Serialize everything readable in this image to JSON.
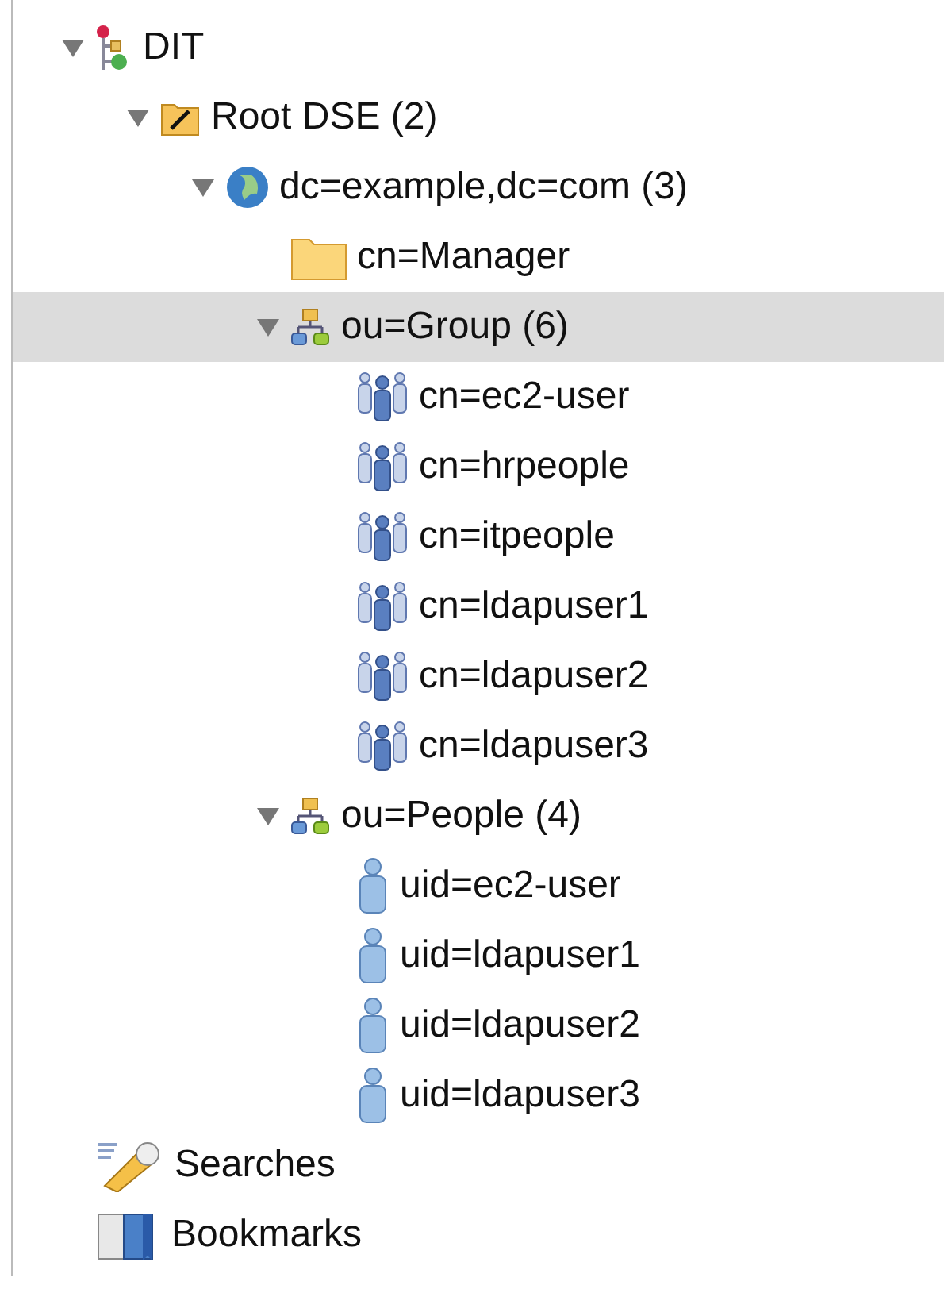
{
  "tree": [
    {
      "kind": "dit",
      "label": "DIT",
      "expanded": true,
      "selected": false,
      "children": [
        {
          "kind": "root",
          "label": "Root DSE (2)",
          "expanded": true,
          "selected": false,
          "children": [
            {
              "kind": "domain",
              "label": "dc=example,dc=com (3)",
              "expanded": true,
              "selected": false,
              "children": [
                {
                  "kind": "folder",
                  "label": "cn=Manager",
                  "selected": false
                },
                {
                  "kind": "ou",
                  "label": "ou=Group (6)",
                  "expanded": true,
                  "selected": true,
                  "children": [
                    {
                      "kind": "group",
                      "label": "cn=ec2-user",
                      "selected": false
                    },
                    {
                      "kind": "group",
                      "label": "cn=hrpeople",
                      "selected": false
                    },
                    {
                      "kind": "group",
                      "label": "cn=itpeople",
                      "selected": false
                    },
                    {
                      "kind": "group",
                      "label": "cn=ldapuser1",
                      "selected": false
                    },
                    {
                      "kind": "group",
                      "label": "cn=ldapuser2",
                      "selected": false
                    },
                    {
                      "kind": "group",
                      "label": "cn=ldapuser3",
                      "selected": false
                    }
                  ]
                },
                {
                  "kind": "ou",
                  "label": "ou=People (4)",
                  "expanded": true,
                  "selected": false,
                  "children": [
                    {
                      "kind": "person",
                      "label": "uid=ec2-user",
                      "selected": false
                    },
                    {
                      "kind": "person",
                      "label": "uid=ldapuser1",
                      "selected": false
                    },
                    {
                      "kind": "person",
                      "label": "uid=ldapuser2",
                      "selected": false
                    },
                    {
                      "kind": "person",
                      "label": "uid=ldapuser3",
                      "selected": false
                    }
                  ]
                }
              ]
            }
          ]
        }
      ]
    },
    {
      "kind": "searches",
      "label": "Searches",
      "selected": false
    },
    {
      "kind": "bookmarks",
      "label": "Bookmarks",
      "selected": false
    }
  ]
}
